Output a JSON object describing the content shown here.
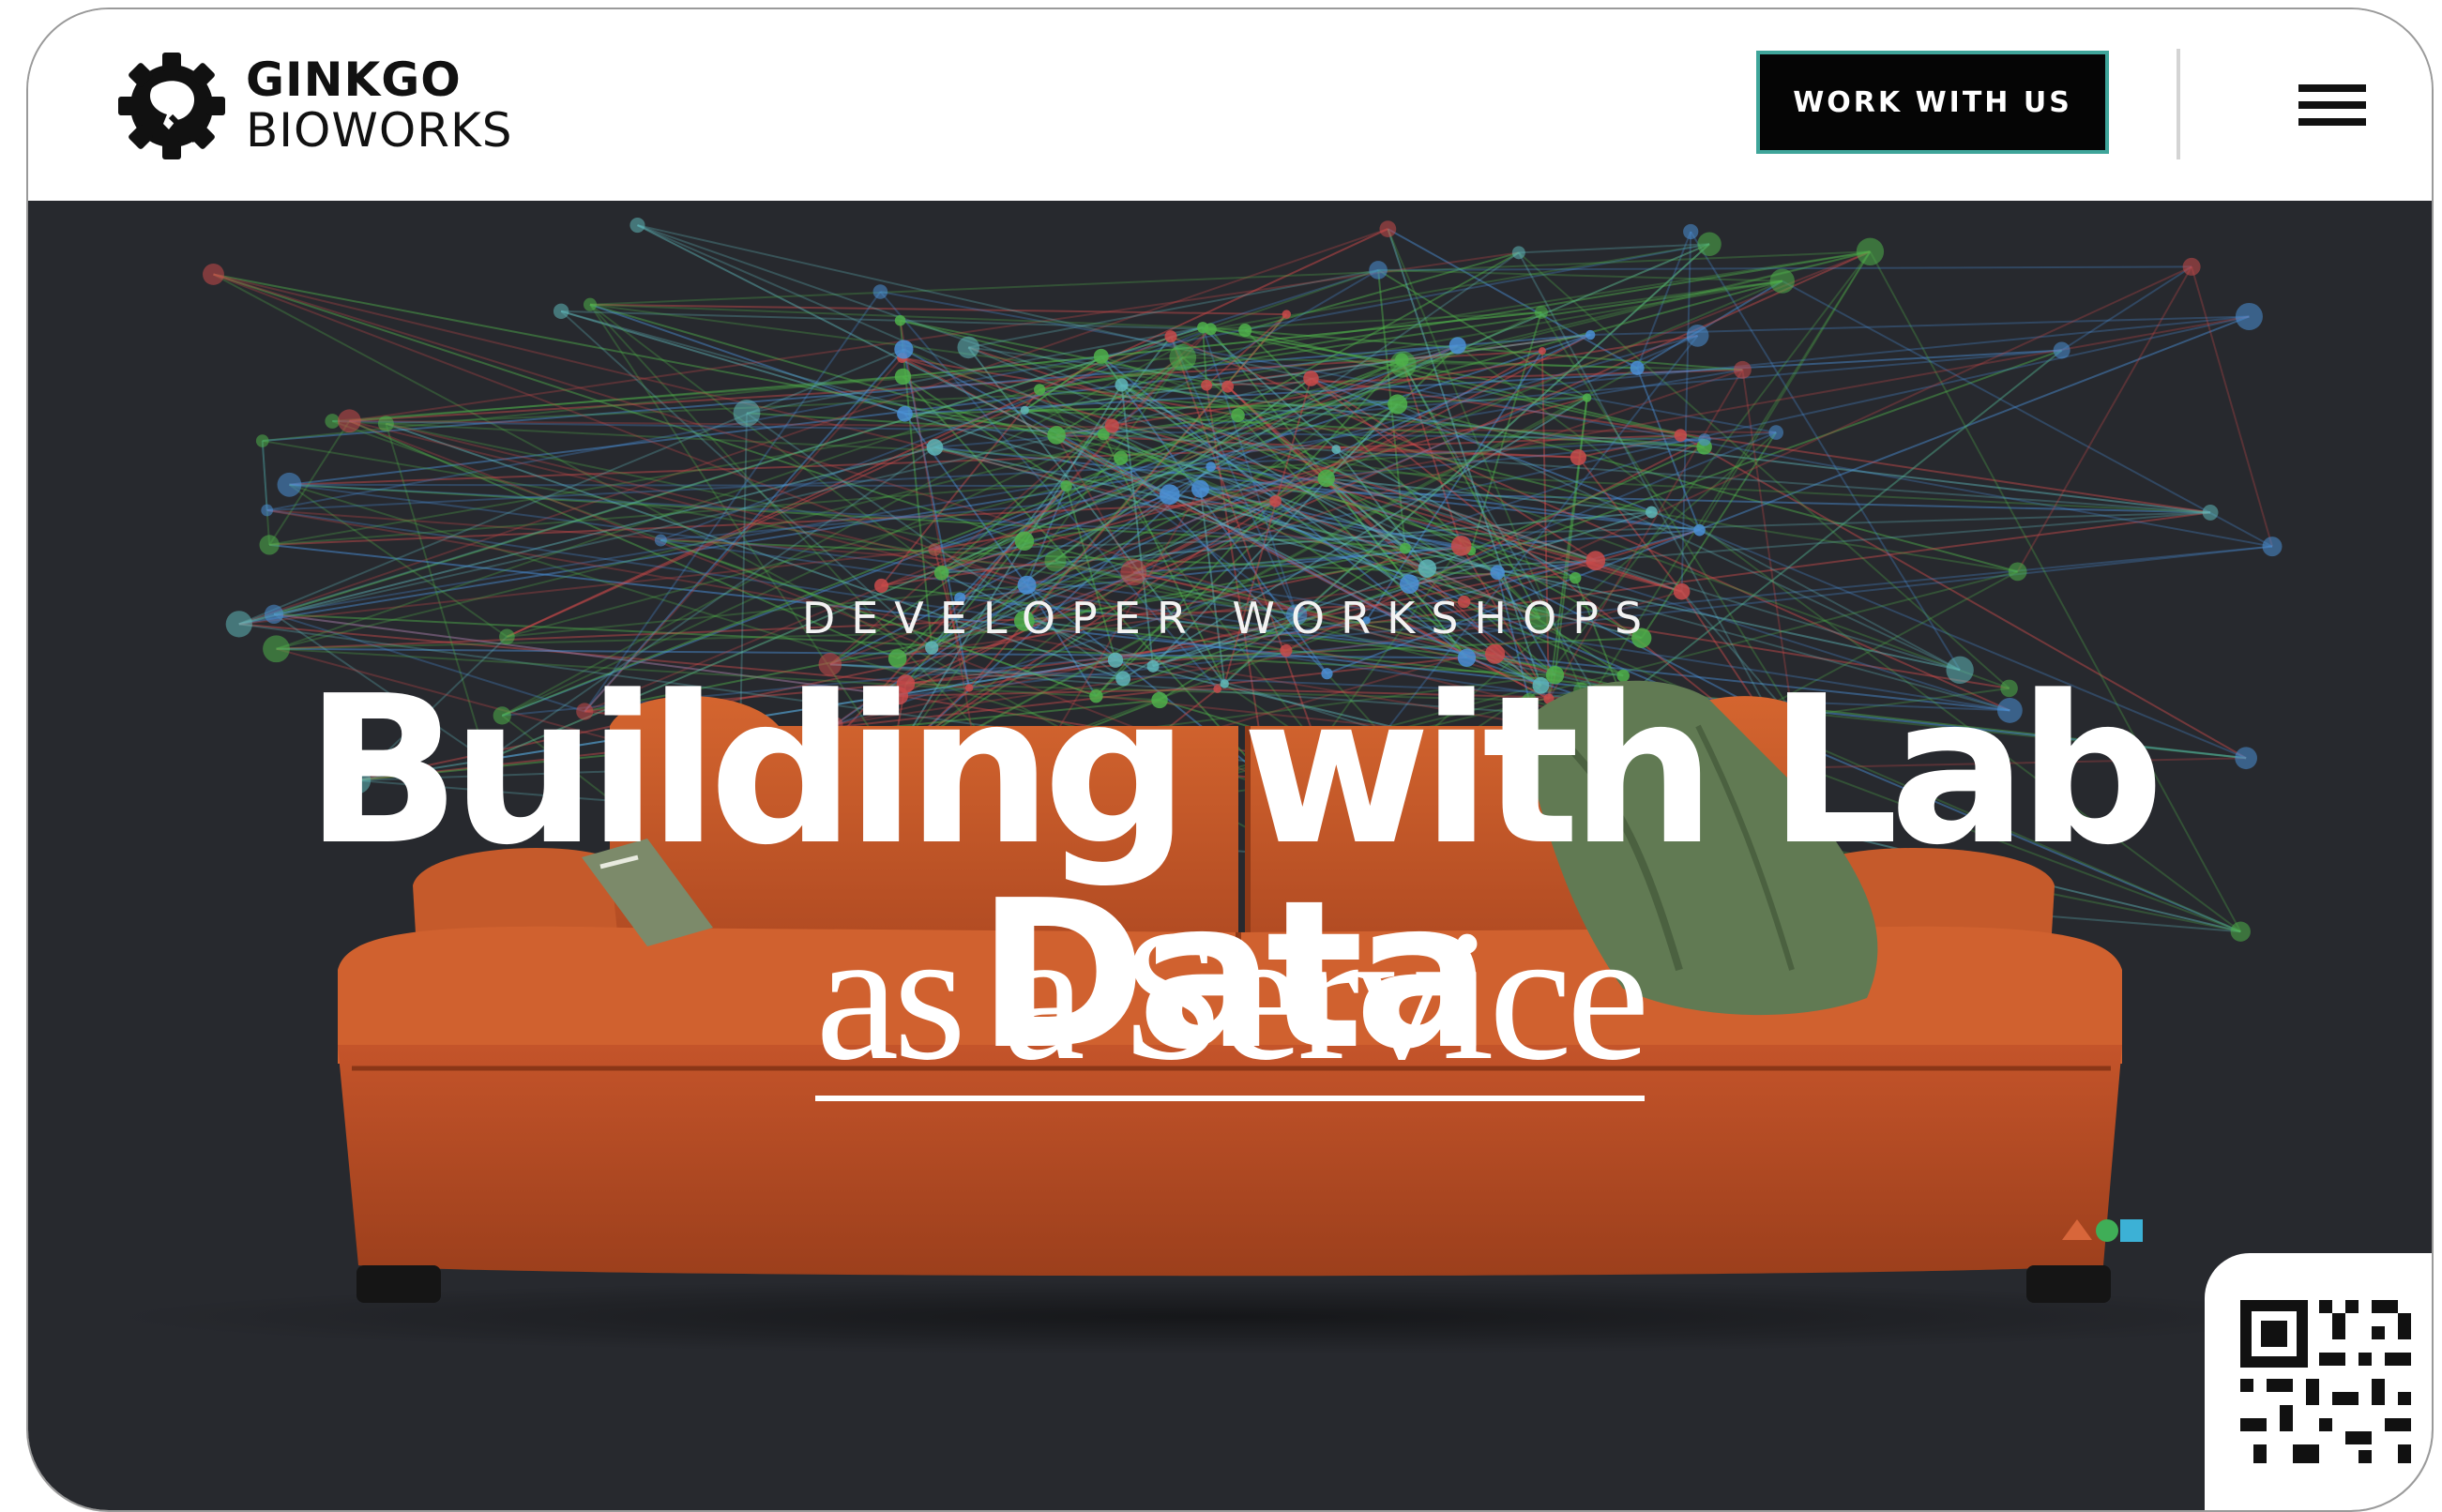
{
  "header": {
    "logo": {
      "line1": "GINKGO",
      "line2": "BIOWORKS",
      "icon": "ginkgo-gear-logo-icon"
    },
    "cta_label": "WORK WITH US",
    "menu_icon": "hamburger-menu-icon"
  },
  "hero": {
    "eyebrow": "DEVELOPER WORKSHOPS",
    "headline": "Building with Lab Data",
    "subhead": "as a Service",
    "shapes_icon": "triangle-circle-square-icon"
  },
  "qr": {
    "icon": "qr-code-icon"
  },
  "colors": {
    "hero_background": "#27292e",
    "sofa": "#c4512a",
    "cta_border": "#3fa59a",
    "node_green": "#4fb04a",
    "node_blue": "#4a8fd6",
    "node_red": "#c94a4a",
    "node_teal": "#5fb6b8"
  }
}
